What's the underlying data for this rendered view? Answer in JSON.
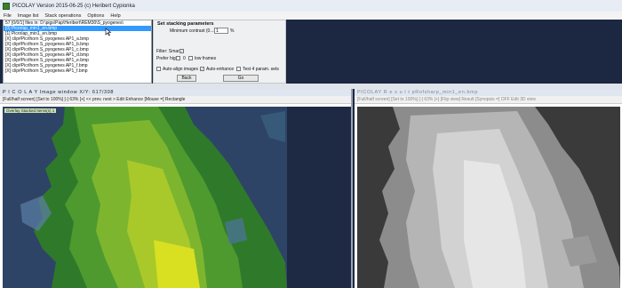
{
  "app": {
    "title": "PICOLAY  Version 2015-06-25  (c) Heribert Cypionka"
  },
  "menu": [
    "File",
    "Image list",
    "Stack operations",
    "Options",
    "Help"
  ],
  "file_list": [
    "57 [0/0/1] files in: D:\\pigs\\Pap\\Heribert\\REM30\\S_pyogenes\\",
    "[0] Picrolap_min1_en.bmp",
    "[1] Picrolap_min1_en.bmp",
    "[X] clip#Picrlhorn S_pyogenes AP1_a.bmp",
    "[X] clip#Picrlhorn S_pyogenes AP1_b.bmp",
    "[X] clip#Picrlhorn S_pyogenes AP1_c.bmp",
    "[X] clip#Picrlhorn S_pyogenes AP1_d.bmp",
    "[X] clip#Picrlhorn S_pyogenes AP1_e.bmp",
    "[X] clip#Picrlhorn S_pyogenes AP1_f.bmp",
    "[X] clip#Picrlhorn S_pyogenes AP1_f.bmp"
  ],
  "params": {
    "title": "Set stacking parameters",
    "min_contrast_label": "Minimum contrast (0...30)",
    "min_contrast_value": "1",
    "min_contrast_unit": "%",
    "filter_label": "Filter: Smart",
    "prefer_label": "Prefer high",
    "prefer_value": "0",
    "low_frames_label": "low frames",
    "auto_align_label": "Auto-align images",
    "auto_enhance_label": "Auto-enhance",
    "test4_label": "Test 4 param. sets",
    "back_label": "Back",
    "go_label": "Go"
  },
  "left_panel": {
    "title": "P I C O L A Y  Image window X/Y: 617/308",
    "toolbar": "[Full/half screen]   [Set to 100%]   [-]   63%   [+]   << prev.   next >   Edit   Enhance   [Mouse =] Rectangle",
    "overlay": "Overlay  Stacked  Items(s) 1"
  },
  "right_panel": {
    "title": "PICOLAY  R e s u l t   pRofsharp_min1_en.bmp",
    "toolbar": "[Full/half screen]   [Set to 100%]   [-]   63%   [+]   [Flip view]   Result   [Synopsis =] OFF   Edit   3D view"
  },
  "colors": {
    "accent": "#3399ff",
    "background": "#1e2a44"
  }
}
